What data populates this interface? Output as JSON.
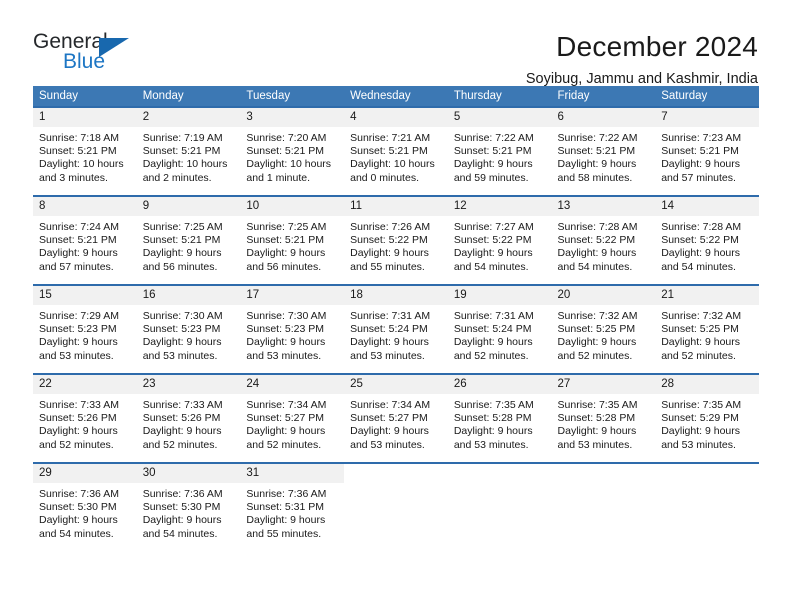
{
  "brand": {
    "name_part1": "General",
    "name_part2": "Blue",
    "logo_icon": "blue-triangle-icon"
  },
  "header": {
    "title": "December 2024",
    "subtitle": "Soyibug, Jammu and Kashmir, India"
  },
  "colors": {
    "header_blue": "#3c78b4",
    "row_divider_blue": "#2e6bab",
    "daynum_band": "#f1f1f1",
    "brand_blue": "#1d76c4",
    "text": "#1a1a1a"
  },
  "weekday_headers": [
    "Sunday",
    "Monday",
    "Tuesday",
    "Wednesday",
    "Thursday",
    "Friday",
    "Saturday"
  ],
  "weeks": [
    [
      {
        "day": "1",
        "sunrise": "Sunrise: 7:18 AM",
        "sunset": "Sunset: 5:21 PM",
        "daylight_l1": "Daylight: 10 hours",
        "daylight_l2": "and 3 minutes."
      },
      {
        "day": "2",
        "sunrise": "Sunrise: 7:19 AM",
        "sunset": "Sunset: 5:21 PM",
        "daylight_l1": "Daylight: 10 hours",
        "daylight_l2": "and 2 minutes."
      },
      {
        "day": "3",
        "sunrise": "Sunrise: 7:20 AM",
        "sunset": "Sunset: 5:21 PM",
        "daylight_l1": "Daylight: 10 hours",
        "daylight_l2": "and 1 minute."
      },
      {
        "day": "4",
        "sunrise": "Sunrise: 7:21 AM",
        "sunset": "Sunset: 5:21 PM",
        "daylight_l1": "Daylight: 10 hours",
        "daylight_l2": "and 0 minutes."
      },
      {
        "day": "5",
        "sunrise": "Sunrise: 7:22 AM",
        "sunset": "Sunset: 5:21 PM",
        "daylight_l1": "Daylight: 9 hours",
        "daylight_l2": "and 59 minutes."
      },
      {
        "day": "6",
        "sunrise": "Sunrise: 7:22 AM",
        "sunset": "Sunset: 5:21 PM",
        "daylight_l1": "Daylight: 9 hours",
        "daylight_l2": "and 58 minutes."
      },
      {
        "day": "7",
        "sunrise": "Sunrise: 7:23 AM",
        "sunset": "Sunset: 5:21 PM",
        "daylight_l1": "Daylight: 9 hours",
        "daylight_l2": "and 57 minutes."
      }
    ],
    [
      {
        "day": "8",
        "sunrise": "Sunrise: 7:24 AM",
        "sunset": "Sunset: 5:21 PM",
        "daylight_l1": "Daylight: 9 hours",
        "daylight_l2": "and 57 minutes."
      },
      {
        "day": "9",
        "sunrise": "Sunrise: 7:25 AM",
        "sunset": "Sunset: 5:21 PM",
        "daylight_l1": "Daylight: 9 hours",
        "daylight_l2": "and 56 minutes."
      },
      {
        "day": "10",
        "sunrise": "Sunrise: 7:25 AM",
        "sunset": "Sunset: 5:21 PM",
        "daylight_l1": "Daylight: 9 hours",
        "daylight_l2": "and 56 minutes."
      },
      {
        "day": "11",
        "sunrise": "Sunrise: 7:26 AM",
        "sunset": "Sunset: 5:22 PM",
        "daylight_l1": "Daylight: 9 hours",
        "daylight_l2": "and 55 minutes."
      },
      {
        "day": "12",
        "sunrise": "Sunrise: 7:27 AM",
        "sunset": "Sunset: 5:22 PM",
        "daylight_l1": "Daylight: 9 hours",
        "daylight_l2": "and 54 minutes."
      },
      {
        "day": "13",
        "sunrise": "Sunrise: 7:28 AM",
        "sunset": "Sunset: 5:22 PM",
        "daylight_l1": "Daylight: 9 hours",
        "daylight_l2": "and 54 minutes."
      },
      {
        "day": "14",
        "sunrise": "Sunrise: 7:28 AM",
        "sunset": "Sunset: 5:22 PM",
        "daylight_l1": "Daylight: 9 hours",
        "daylight_l2": "and 54 minutes."
      }
    ],
    [
      {
        "day": "15",
        "sunrise": "Sunrise: 7:29 AM",
        "sunset": "Sunset: 5:23 PM",
        "daylight_l1": "Daylight: 9 hours",
        "daylight_l2": "and 53 minutes."
      },
      {
        "day": "16",
        "sunrise": "Sunrise: 7:30 AM",
        "sunset": "Sunset: 5:23 PM",
        "daylight_l1": "Daylight: 9 hours",
        "daylight_l2": "and 53 minutes."
      },
      {
        "day": "17",
        "sunrise": "Sunrise: 7:30 AM",
        "sunset": "Sunset: 5:23 PM",
        "daylight_l1": "Daylight: 9 hours",
        "daylight_l2": "and 53 minutes."
      },
      {
        "day": "18",
        "sunrise": "Sunrise: 7:31 AM",
        "sunset": "Sunset: 5:24 PM",
        "daylight_l1": "Daylight: 9 hours",
        "daylight_l2": "and 53 minutes."
      },
      {
        "day": "19",
        "sunrise": "Sunrise: 7:31 AM",
        "sunset": "Sunset: 5:24 PM",
        "daylight_l1": "Daylight: 9 hours",
        "daylight_l2": "and 52 minutes."
      },
      {
        "day": "20",
        "sunrise": "Sunrise: 7:32 AM",
        "sunset": "Sunset: 5:25 PM",
        "daylight_l1": "Daylight: 9 hours",
        "daylight_l2": "and 52 minutes."
      },
      {
        "day": "21",
        "sunrise": "Sunrise: 7:32 AM",
        "sunset": "Sunset: 5:25 PM",
        "daylight_l1": "Daylight: 9 hours",
        "daylight_l2": "and 52 minutes."
      }
    ],
    [
      {
        "day": "22",
        "sunrise": "Sunrise: 7:33 AM",
        "sunset": "Sunset: 5:26 PM",
        "daylight_l1": "Daylight: 9 hours",
        "daylight_l2": "and 52 minutes."
      },
      {
        "day": "23",
        "sunrise": "Sunrise: 7:33 AM",
        "sunset": "Sunset: 5:26 PM",
        "daylight_l1": "Daylight: 9 hours",
        "daylight_l2": "and 52 minutes."
      },
      {
        "day": "24",
        "sunrise": "Sunrise: 7:34 AM",
        "sunset": "Sunset: 5:27 PM",
        "daylight_l1": "Daylight: 9 hours",
        "daylight_l2": "and 52 minutes."
      },
      {
        "day": "25",
        "sunrise": "Sunrise: 7:34 AM",
        "sunset": "Sunset: 5:27 PM",
        "daylight_l1": "Daylight: 9 hours",
        "daylight_l2": "and 53 minutes."
      },
      {
        "day": "26",
        "sunrise": "Sunrise: 7:35 AM",
        "sunset": "Sunset: 5:28 PM",
        "daylight_l1": "Daylight: 9 hours",
        "daylight_l2": "and 53 minutes."
      },
      {
        "day": "27",
        "sunrise": "Sunrise: 7:35 AM",
        "sunset": "Sunset: 5:28 PM",
        "daylight_l1": "Daylight: 9 hours",
        "daylight_l2": "and 53 minutes."
      },
      {
        "day": "28",
        "sunrise": "Sunrise: 7:35 AM",
        "sunset": "Sunset: 5:29 PM",
        "daylight_l1": "Daylight: 9 hours",
        "daylight_l2": "and 53 minutes."
      }
    ],
    [
      {
        "day": "29",
        "sunrise": "Sunrise: 7:36 AM",
        "sunset": "Sunset: 5:30 PM",
        "daylight_l1": "Daylight: 9 hours",
        "daylight_l2": "and 54 minutes."
      },
      {
        "day": "30",
        "sunrise": "Sunrise: 7:36 AM",
        "sunset": "Sunset: 5:30 PM",
        "daylight_l1": "Daylight: 9 hours",
        "daylight_l2": "and 54 minutes."
      },
      {
        "day": "31",
        "sunrise": "Sunrise: 7:36 AM",
        "sunset": "Sunset: 5:31 PM",
        "daylight_l1": "Daylight: 9 hours",
        "daylight_l2": "and 55 minutes."
      },
      {
        "day": "",
        "sunrise": "",
        "sunset": "",
        "daylight_l1": "",
        "daylight_l2": ""
      },
      {
        "day": "",
        "sunrise": "",
        "sunset": "",
        "daylight_l1": "",
        "daylight_l2": ""
      },
      {
        "day": "",
        "sunrise": "",
        "sunset": "",
        "daylight_l1": "",
        "daylight_l2": ""
      },
      {
        "day": "",
        "sunrise": "",
        "sunset": "",
        "daylight_l1": "",
        "daylight_l2": ""
      }
    ]
  ]
}
